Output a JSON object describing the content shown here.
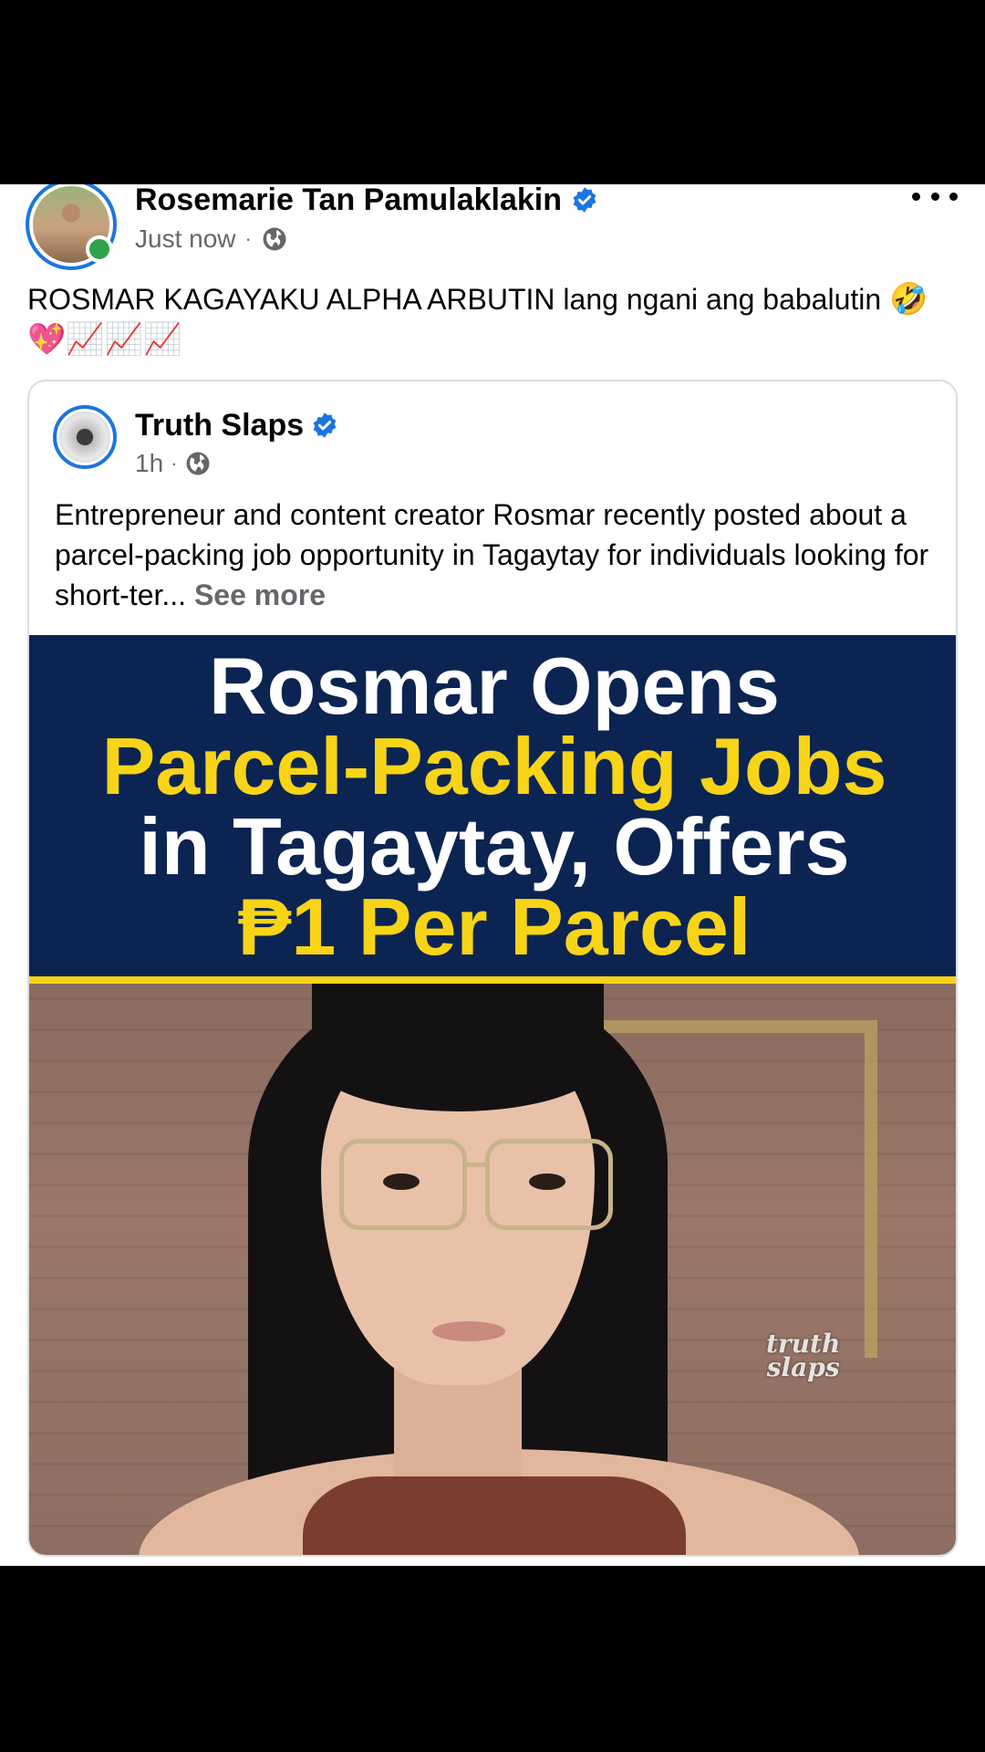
{
  "post": {
    "author_name": "Rosemarie Tan Pamulaklakin",
    "timestamp": "Just now",
    "separator": "·",
    "privacy_icon": "globe-icon",
    "verified_icon": "verified-badge-icon",
    "more_icon": "more-options-icon",
    "caption_text": "ROSMAR KAGAYAKU ALPHA ARBUTIN lang ngani ang babalutin",
    "caption_emojis": "🤣💖📈📈📈"
  },
  "shared": {
    "author_name": "Truth Slaps",
    "timestamp": "1h",
    "separator": "·",
    "body_text": "Entrepreneur and content creator Rosmar recently posted about a parcel-packing job opportunity in Tagaytay for individuals looking for short-ter...",
    "see_more": "See more",
    "image": {
      "line1": "Rosmar Opens",
      "line2": "Parcel-Packing Jobs",
      "line3": "in Tagaytay, Offers",
      "line4": "₱1 Per Parcel",
      "watermark_line1": "truth",
      "watermark_line2": "slaps"
    }
  },
  "colors": {
    "accent": "#1b74e4",
    "banner_bg": "#0c2452",
    "banner_yellow": "#f7d417",
    "online": "#31a24c",
    "meta_gray": "#65676b"
  }
}
